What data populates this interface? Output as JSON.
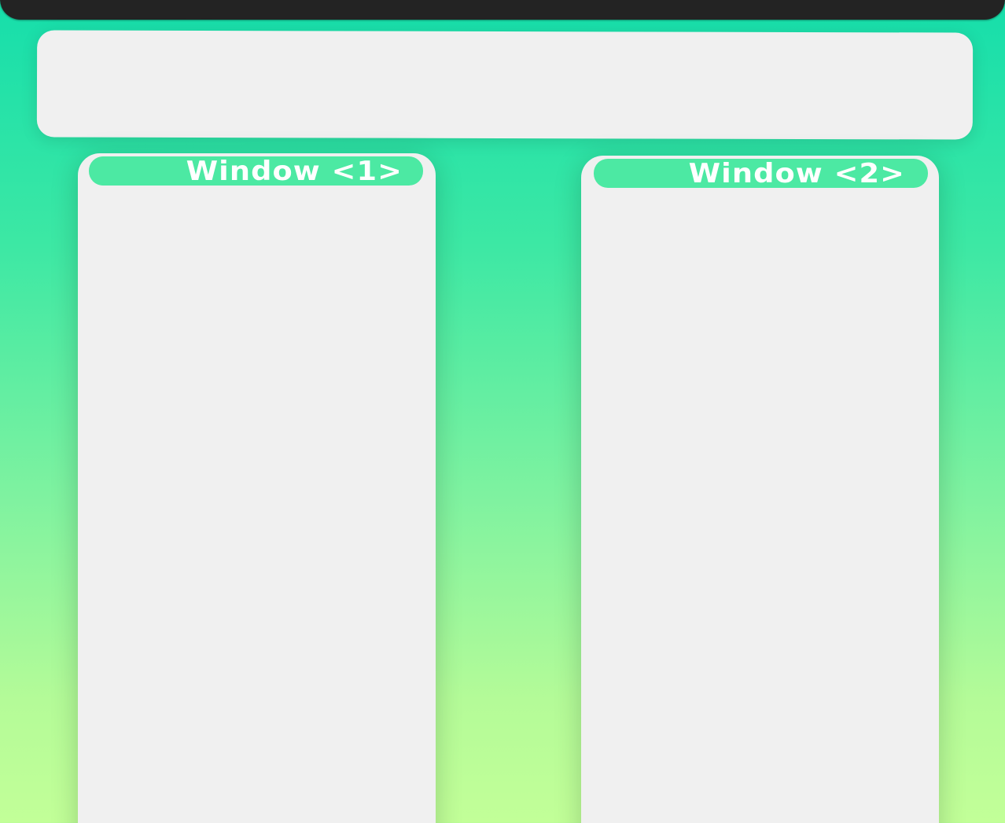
{
  "windows": [
    {
      "title": "Window <1>"
    },
    {
      "title": "Window <2>"
    }
  ],
  "colors": {
    "background_top": "#16deab",
    "background_bottom": "#c2ff98",
    "top_bar": "#232323",
    "panel": "#f0f0f0",
    "title_pill": "#4ce9a3",
    "title_text": "#ffffff"
  }
}
